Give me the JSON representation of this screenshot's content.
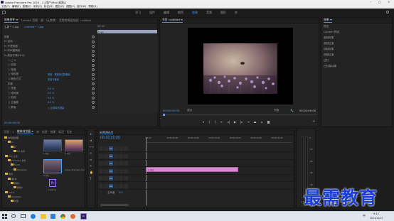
{
  "window": {
    "title": "Adobe Premiere Pro 2020 - C:\\用户\\Mac\\桌面\\1",
    "controls": [
      "–",
      "□",
      "×"
    ]
  },
  "menubar": [
    "文件(F)",
    "编辑(E)",
    "剪辑(C)",
    "序列(S)",
    "标记(M)",
    "图形(G)",
    "视图(V)",
    "窗口(W)",
    "帮助(H)"
  ],
  "workspaces": [
    "学习",
    "组件",
    "编辑",
    "颜色",
    "效果",
    "音频",
    "图形",
    "库"
  ],
  "workspace_active": "效果",
  "effect_controls": {
    "tabs": [
      "效果控件 ≡",
      "Lumetri 范围",
      "源：(无剪辑)",
      "音频剪辑混合器：untitled"
    ],
    "source_label": "主要 * 1.jpg",
    "sequence_label": "untitled * 1.jpg",
    "timecode_head": "00:00",
    "clip_bar_label": "1.jpg",
    "rows": [
      {
        "label": "视频",
        "value": ""
      },
      {
        "label": "fx 运动",
        "value": ""
      },
      {
        "label": "fx 不透明度",
        "value": ""
      },
      {
        "label": "fx 时间重映射",
        "value": ""
      },
      {
        "label": "fx 颜色平衡(HLS)",
        "value": ""
      },
      {
        "label": "⬭ ▢ ✒",
        "value": ""
      },
      {
        "label": "○ 色相",
        "value": ""
      },
      {
        "label": "○ 亮度",
        "value": ""
      },
      {
        "label": "○ 饱和度",
        "value": "单值：黑颜色控制像素"
      },
      {
        "label": "○ 颜色方式",
        "value": "宏量与像素"
      },
      {
        "label": "阴影",
        "value": ""
      },
      {
        "label": "○ 亮度",
        "value": "0.0 %"
      },
      {
        "label": "○ 饱和度",
        "value": "0.0 %"
      },
      {
        "label": "○ 色相",
        "value": "0.0 %"
      },
      {
        "label": "○ 去偏移",
        "value": "0.0 %"
      },
      {
        "label": "○ 蒙版",
        "value": "□ 反转填充渲染"
      }
    ],
    "footer_time": "00:00:00:00"
  },
  "program": {
    "tab": "节目: untitled ≡",
    "timecode_left": "00:00:00:00",
    "fit": "适合",
    "quality": "完整",
    "timecode_right": "00:00:05:00",
    "ruler_left": "00:00",
    "ruler_right": "00:00:05:00"
  },
  "effects_panel": {
    "title": "效果 ≡",
    "items": [
      "预设",
      "Lumetri 预设",
      "音频效果",
      "音频过渡",
      "视频效果",
      "视频过渡",
      "过时",
      "已封装效果"
    ]
  },
  "project": {
    "tabs": [
      "项目：1",
      "媒体浏览器 ≡",
      "库",
      "信息",
      "效果",
      "标记",
      "历史"
    ],
    "tree": [
      "本地驱动器",
      "C:",
      "D:",
      "CC 文件",
      "PDF 文件",
      "Premiere 文件",
      "Tomb",
      "Windows",
      "素材",
      "素材1",
      "视频1",
      "视频2",
      "Users",
      "Windows",
      "内容"
    ],
    "thumbs": [
      {
        "label": "1.jpg",
        "dur": ""
      },
      {
        "label": "2.jpg",
        "dur": ""
      },
      {
        "label": "3.jpg",
        "dur": ""
      },
      {
        "label": "Adobe Premiere Pro...",
        "dur": ""
      },
      {
        "label": "1.prproj",
        "dur": ""
      }
    ]
  },
  "timeline": {
    "tab": "untitled ≡",
    "timecode": "00:00:00:00",
    "ruler": [
      "00:00",
      "00:00:05:00",
      "00:00:10:00",
      "00:00:15:00",
      "00:00:20:00",
      "00:00:25:00",
      "00:00:30:00"
    ],
    "video_tracks": [
      "V3",
      "V2",
      "V1"
    ],
    "audio_tracks": [
      "A1",
      "A2",
      "A3"
    ],
    "master": "主声道",
    "master_val": "0.0",
    "clip_label": "1.jpg",
    "clip_color": "#d48bd1"
  },
  "audio_meter": {
    "labels": [
      "0",
      "-12",
      "-24",
      "-36",
      "-48",
      "dB"
    ],
    "s": "S S"
  },
  "watermark": "最需教育",
  "taskbar": {
    "time": "9:12",
    "date": "2021/11/12",
    "lang": "中"
  },
  "colors": {
    "accent_blue": "#4e9df5",
    "clip_pink": "#d48bd1",
    "watermark_blue": "#1a3dd6"
  }
}
